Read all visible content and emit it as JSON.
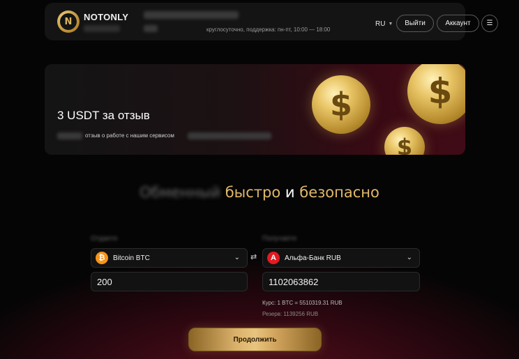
{
  "header": {
    "brand": "NOTONLY",
    "support_text": "круглосуточно, поддержка: пн-пт, 10:00 — 18:00",
    "lang": "RU",
    "exit_label": "Выйти",
    "account_label": "Аккаунт",
    "menu_icon": "☰"
  },
  "banner": {
    "title": "3 USDT за отзыв",
    "text": "отзыв о работе с нашим сервисом"
  },
  "headline": {
    "part1": "Обменный",
    "part2": "быстро",
    "part3": "и",
    "part4": "безопасно"
  },
  "exchange": {
    "from_label": "Отдаете",
    "to_label": "Получаете",
    "from_currency": "Bitcoin BTC",
    "to_currency": "Альфа-Банк RUB",
    "from_amount": "200",
    "to_amount": "1102063862",
    "rate": "Курс: 1 BTC = 5510319.31 RUB",
    "reserve": "Резерв: 1139256 RUB",
    "swap_icon": "⇄",
    "continue_label": "Продолжить"
  },
  "colors": {
    "accent_gold": "#e0b86a",
    "background": "#050505",
    "btc_orange": "#f7931a",
    "alfa_red": "#e11b22"
  }
}
